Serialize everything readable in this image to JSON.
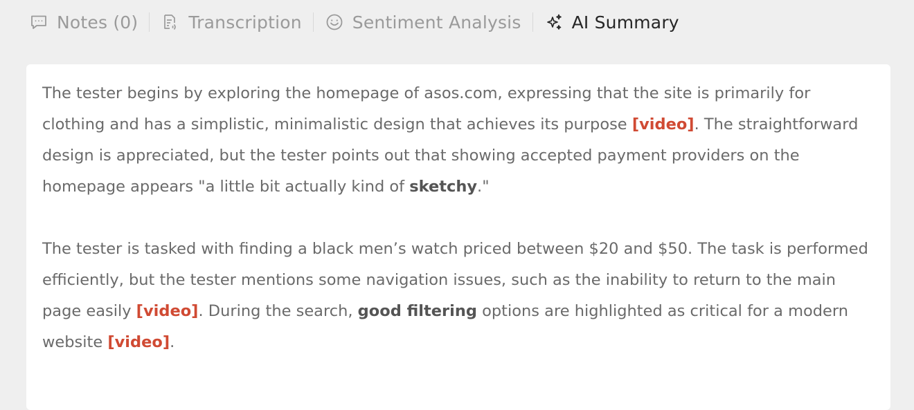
{
  "tabs": {
    "notes": "Notes (0)",
    "transcription": "Transcription",
    "sentiment": "Sentiment Analysis",
    "summary": "AI Summary"
  },
  "summary": {
    "p1": {
      "a": "The tester begins by exploring the homepage of asos.com, expressing that the site is primarily for clothing and has a simplistic, minimalistic design that achieves its purpose ",
      "link1": "[video]",
      "b": ". The straightforward design is appreciated, but the tester points out that showing accepted payment providers on the homepage appears \"a little bit actually kind of ",
      "bold1": "sketchy",
      "c": ".\""
    },
    "p2": {
      "a": "The tester is tasked with finding a black men’s watch priced between $20 and $50. The task is performed efficiently, but the tester mentions some navigation issues, such as the inability to return to the main page easily ",
      "link1": "[video]",
      "b": ". During the search, ",
      "bold1": "good filtering",
      "c": " options are highlighted as critical for a modern website ",
      "link2": "[video]",
      "d": "."
    }
  },
  "colors": {
    "background": "#efefef",
    "card": "#ffffff",
    "link": "#d04a33",
    "active_tab": "#262626",
    "inactive_tab": "#9a9a9a"
  }
}
